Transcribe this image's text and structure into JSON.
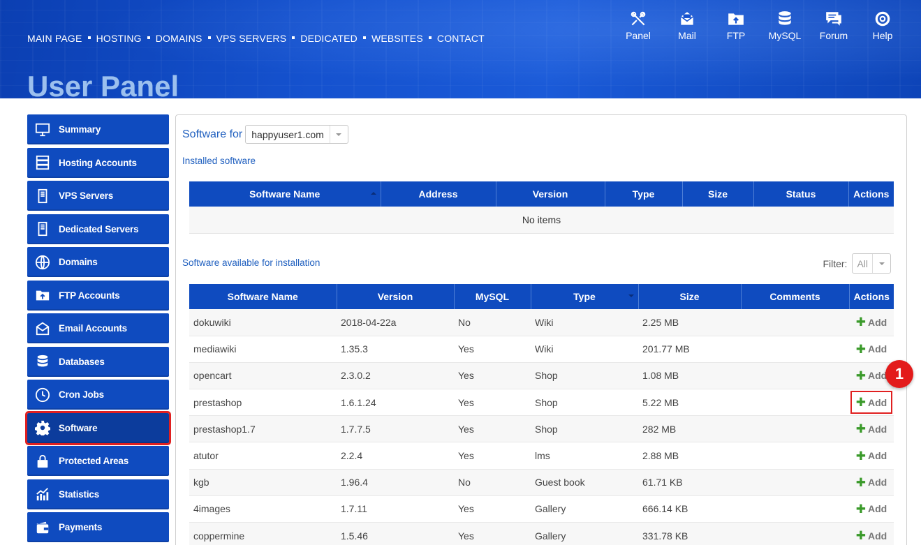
{
  "topnav": [
    "MAIN PAGE",
    "HOSTING",
    "DOMAINS",
    "VPS SERVERS",
    "DEDICATED",
    "WEBSITES",
    "CONTACT"
  ],
  "iconnav": [
    {
      "label": "Panel",
      "icon": "tools-icon"
    },
    {
      "label": "Mail",
      "icon": "mail-icon"
    },
    {
      "label": "FTP",
      "icon": "ftp-folder-icon"
    },
    {
      "label": "MySQL",
      "icon": "database-icon"
    },
    {
      "label": "Forum",
      "icon": "forum-chat-icon"
    },
    {
      "label": "Help",
      "icon": "lifebuoy-icon"
    }
  ],
  "page_title": "User Panel",
  "sidebar": {
    "items": [
      {
        "label": "Summary",
        "icon": "monitor-icon"
      },
      {
        "label": "Hosting Accounts",
        "icon": "server-rack-icon"
      },
      {
        "label": "VPS Servers",
        "icon": "server-tower-icon"
      },
      {
        "label": "Dedicated Servers",
        "icon": "server-tower-icon"
      },
      {
        "label": "Domains",
        "icon": "www-globe-icon"
      },
      {
        "label": "FTP Accounts",
        "icon": "ftp-folder-icon"
      },
      {
        "label": "Email Accounts",
        "icon": "envelope-icon"
      },
      {
        "label": "Databases",
        "icon": "database-icon"
      },
      {
        "label": "Cron Jobs",
        "icon": "clock-icon"
      },
      {
        "label": "Software",
        "icon": "gear-icon",
        "active": true
      },
      {
        "label": "Protected Areas",
        "icon": "lock-icon"
      },
      {
        "label": "Statistics",
        "icon": "chart-icon"
      },
      {
        "label": "Payments",
        "icon": "wallet-icon"
      }
    ]
  },
  "software_for": {
    "label": "Software for",
    "selected": "happyuser1.com"
  },
  "installed": {
    "label": "Installed software",
    "columns": [
      "Software Name",
      "Address",
      "Version",
      "Type",
      "Size",
      "Status",
      "Actions"
    ],
    "empty_text": "No items"
  },
  "available": {
    "label": "Software available for installation",
    "filter_label": "Filter:",
    "filter_value": "All",
    "columns": [
      "Software Name",
      "Version",
      "MySQL",
      "Type",
      "Size",
      "Comments",
      "Actions"
    ],
    "add_label": "Add",
    "rows": [
      {
        "name": "dokuwiki",
        "version": "2018-04-22a",
        "mysql": "No",
        "type": "Wiki",
        "size": "2.25 MB",
        "comments": ""
      },
      {
        "name": "mediawiki",
        "version": "1.35.3",
        "mysql": "Yes",
        "type": "Wiki",
        "size": "201.77 MB",
        "comments": ""
      },
      {
        "name": "opencart",
        "version": "2.3.0.2",
        "mysql": "Yes",
        "type": "Shop",
        "size": "1.08 MB",
        "comments": ""
      },
      {
        "name": "prestashop",
        "version": "1.6.1.24",
        "mysql": "Yes",
        "type": "Shop",
        "size": "5.22 MB",
        "comments": "",
        "highlight": true
      },
      {
        "name": "prestashop1.7",
        "version": "1.7.7.5",
        "mysql": "Yes",
        "type": "Shop",
        "size": "282 MB",
        "comments": ""
      },
      {
        "name": "atutor",
        "version": "2.2.4",
        "mysql": "Yes",
        "type": "lms",
        "size": "2.88 MB",
        "comments": ""
      },
      {
        "name": "kgb",
        "version": "1.96.4",
        "mysql": "No",
        "type": "Guest book",
        "size": "61.71 KB",
        "comments": ""
      },
      {
        "name": "4images",
        "version": "1.7.11",
        "mysql": "Yes",
        "type": "Gallery",
        "size": "666.14 KB",
        "comments": ""
      },
      {
        "name": "coppermine",
        "version": "1.5.46",
        "mysql": "Yes",
        "type": "Gallery",
        "size": "331.78 KB",
        "comments": ""
      }
    ]
  },
  "callout": "1",
  "colors": {
    "primary": "#0f4bbf",
    "highlight": "#e02020",
    "link": "#1f5fbf",
    "add_plus": "#3a9a2a"
  }
}
